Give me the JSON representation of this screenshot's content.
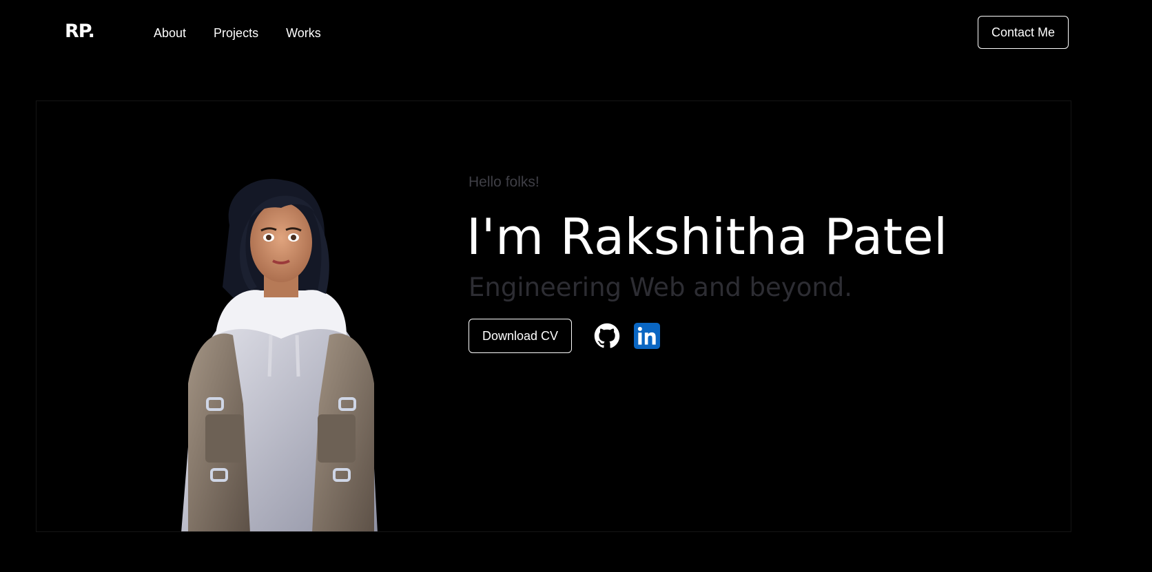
{
  "header": {
    "logo": "RP.",
    "nav": [
      {
        "label": "About"
      },
      {
        "label": "Projects"
      },
      {
        "label": "Works"
      }
    ],
    "contact_label": "Contact Me"
  },
  "hero": {
    "greeting": "Hello folks!",
    "name": "I'm Rakshitha Patel",
    "tagline": "Engineering Web and beyond.",
    "cv_label": "Download CV",
    "social": [
      {
        "icon": "github-icon"
      },
      {
        "icon": "linkedin-icon",
        "color": "#0a66c2"
      }
    ]
  },
  "colors": {
    "background": "#000000",
    "text": "#ffffff",
    "muted": "#3f3f46"
  }
}
